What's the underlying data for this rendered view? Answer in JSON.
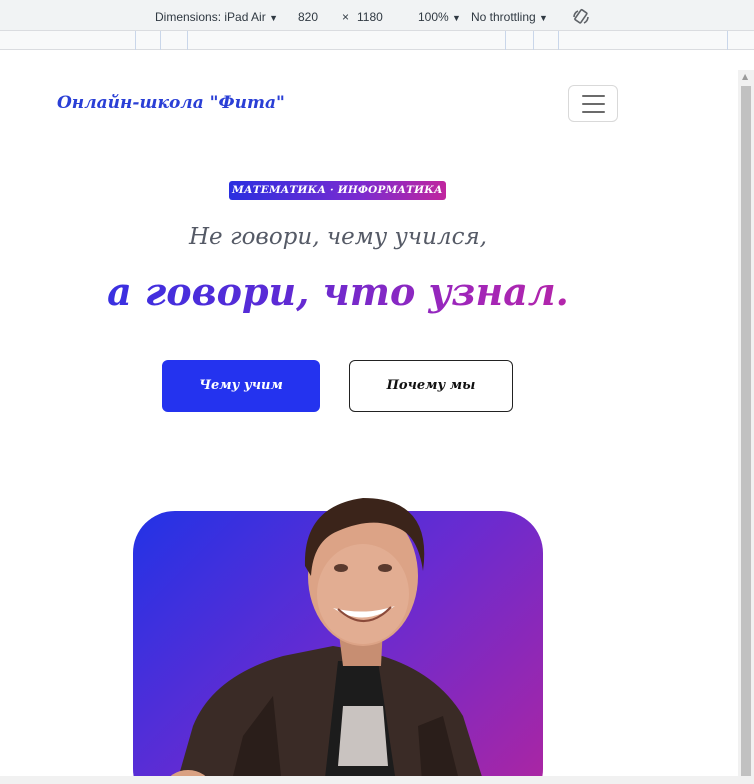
{
  "devtools": {
    "dimensions_label": "Dimensions: iPad Air",
    "width": "820",
    "times": "×",
    "height": "1180",
    "zoom": "100%",
    "throttling": "No throttling"
  },
  "site": {
    "brand": "Онлайн-школа \"Фита\"",
    "badge": "МАТЕМАТИКА · ИНФОРМАТИКА",
    "hero_line1": "Не говори, чему учился,",
    "hero_line2": "а говори, что узнал.",
    "primary_button": "Чему учим",
    "secondary_button": "Почему мы"
  },
  "colors": {
    "accent": "#2433ef",
    "gradient_start": "#2233e6",
    "gradient_end": "#c8249a"
  }
}
